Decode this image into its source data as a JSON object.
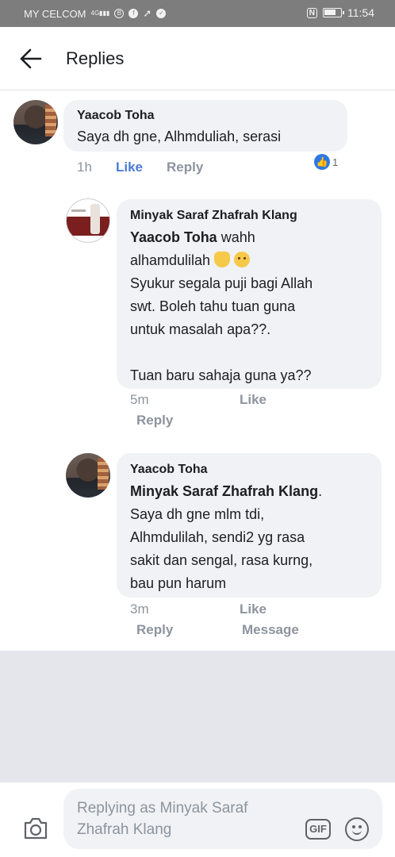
{
  "status_bar": {
    "carrier": "MY CELCOM",
    "network": "4G",
    "time": "11:54",
    "nfc": "N"
  },
  "header": {
    "title": "Replies"
  },
  "comments": [
    {
      "author": "Yaacob Toha",
      "text": "Saya dh gne,  Alhmduliah,  serasi",
      "time": "1h",
      "like_label": "Like",
      "reply_label": "Reply",
      "reaction_count": "1"
    },
    {
      "author": "Minyak Saraf Zhafrah  Klang",
      "mention": "Yaacob Toha",
      "line1_rest": " wahh",
      "line2": "alhamdulilah ",
      "line3": "Syukur segala puji bagi Allah",
      "line4": "swt. Boleh tahu tuan guna",
      "line5": "untuk masalah apa??.",
      "line6": "Tuan baru sahaja guna ya??",
      "time": "5m",
      "like_label": "Like",
      "reply_label": "Reply"
    },
    {
      "author": "Yaacob Toha",
      "mention": "Minyak Saraf Zhafrah  Klang",
      "mention_suffix": ".",
      "line2": "Saya dh gne mlm tdi,",
      "line3": "Alhmdulilah,  sendi2 yg rasa",
      "line4": "sakit dan sengal,  rasa kurng,",
      "line5": "bau pun harum",
      "time": "3m",
      "like_label": "Like",
      "reply_label": "Reply",
      "message_label": "Message"
    }
  ],
  "composer": {
    "placeholder": "Replying as Minyak Saraf Zhafrah  Klang",
    "gif_label": "GIF"
  },
  "colors": {
    "like_active": "#4b7bd8",
    "bubble": "#f0f2f5",
    "status_bar": "#7d7d7d",
    "reaction_blue": "#2c78e4"
  }
}
